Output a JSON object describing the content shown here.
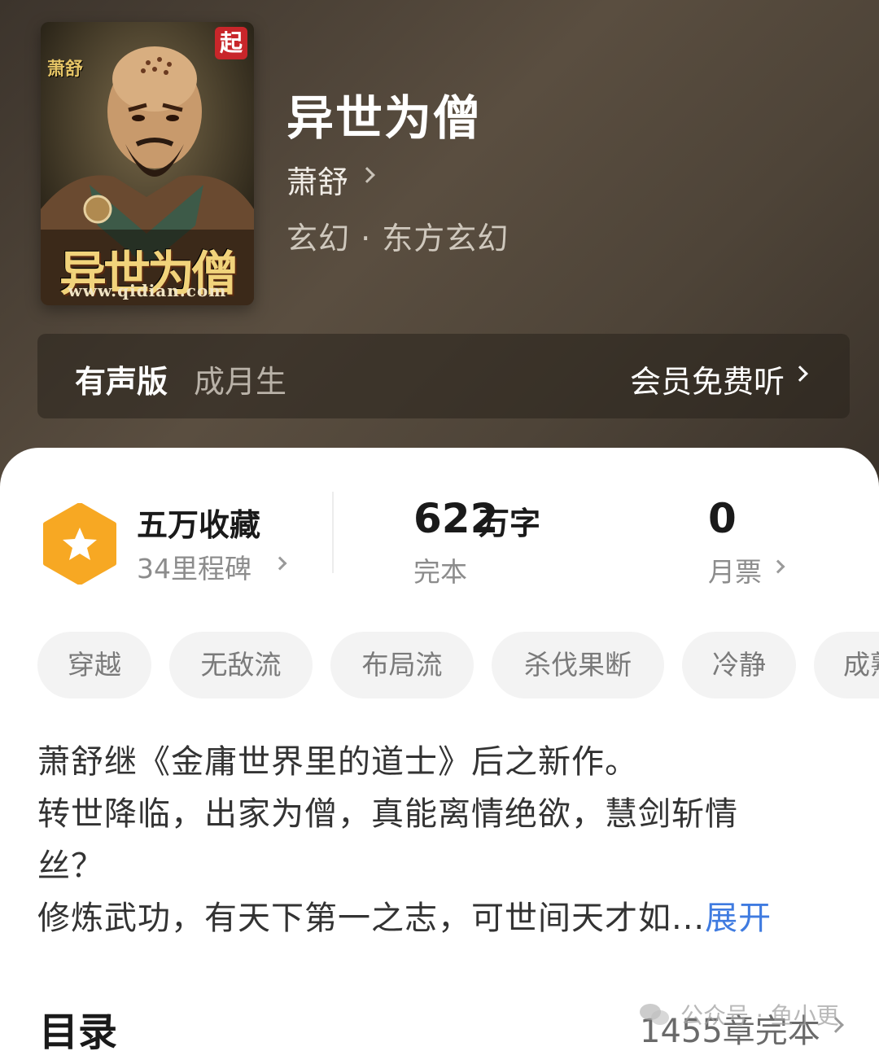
{
  "book": {
    "title": "异世为僧",
    "author": "萧舒",
    "genre": "玄幻 · 东方玄幻"
  },
  "cover": {
    "author_text": "萧舒",
    "badge": "起",
    "title_text": "异世为僧",
    "url": "www.qidian.com"
  },
  "audio": {
    "label": "有声版",
    "narrator": "成月生",
    "cta": "会员免费听"
  },
  "stats": {
    "favorites": {
      "main": "五万收藏",
      "sub": "34里程碑"
    },
    "words": {
      "number": "622",
      "unit": "万字",
      "status": "完本"
    },
    "tickets": {
      "number": "0",
      "label": "月票"
    }
  },
  "tags": [
    "穿越",
    "无敌流",
    "布局流",
    "杀伐果断",
    "冷静",
    "成熟"
  ],
  "description": {
    "line1": "萧舒继《金庸世界里的道士》后之新作。",
    "line2": "转世降临，出家为僧，真能离情绝欲，慧剑斩情",
    "line3": "丝？",
    "line4": "修炼武功，有天下第一之志，可世间天才如...",
    "expand": "展开"
  },
  "toc": {
    "title": "目录",
    "info": "1455章完本"
  },
  "watermark": "公众号 · 鱼小更",
  "colors": {
    "accent_link": "#3f7be0",
    "badge_orange": "#f7a823",
    "cover_badge_red": "#c8262a"
  }
}
